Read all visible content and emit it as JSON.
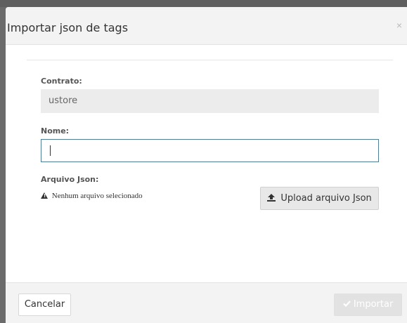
{
  "modal": {
    "title": "Importar json de tags",
    "close_glyph": "×"
  },
  "form": {
    "contrato_label": "Contrato:",
    "contrato_value": "ustore",
    "nome_label": "Nome:",
    "nome_value": "",
    "arquivo_label": "Arquivo Json:",
    "no_file_text": "Nenhum arquivo selecionado",
    "upload_label": "Upload arquivo Json"
  },
  "footer": {
    "cancel_label": "Cancelar",
    "import_label": "Importar"
  },
  "icons": {
    "warning": "warning-icon",
    "upload": "upload-icon",
    "check": "check-icon"
  }
}
